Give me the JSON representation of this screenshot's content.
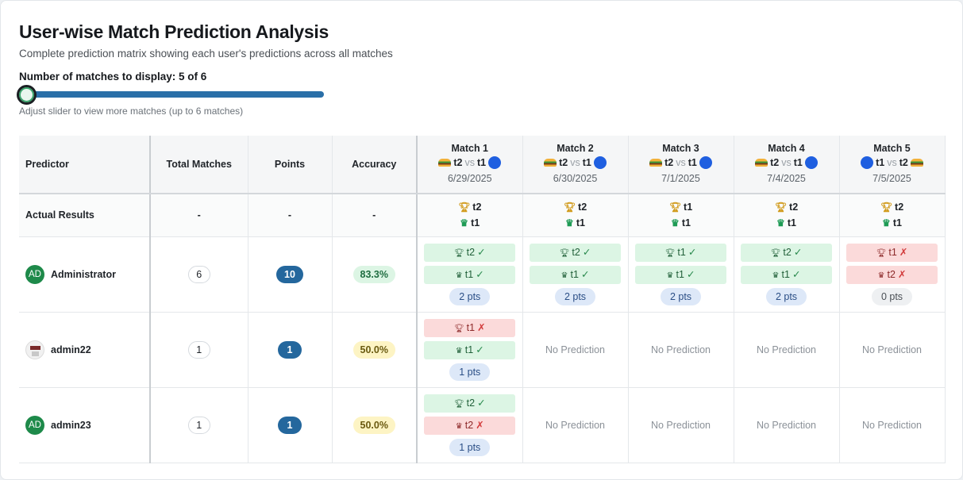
{
  "header": {
    "title": "User-wise Match Prediction Analysis",
    "subtitle": "Complete prediction matrix showing each user's predictions across all matches"
  },
  "slider": {
    "label": "Number of matches to display: 5 of 6",
    "value": 5,
    "max": 6,
    "hint": "Adjust slider to view more matches (up to 6 matches)"
  },
  "table": {
    "columns": {
      "predictor": "Predictor",
      "total": "Total Matches",
      "points": "Points",
      "accuracy": "Accuracy"
    },
    "vs": "vs",
    "matches": [
      {
        "title": "Match 1",
        "team_a": "t2",
        "team_b": "t1",
        "date": "6/29/2025"
      },
      {
        "title": "Match 2",
        "team_a": "t2",
        "team_b": "t1",
        "date": "6/30/2025"
      },
      {
        "title": "Match 3",
        "team_a": "t2",
        "team_b": "t1",
        "date": "7/1/2025"
      },
      {
        "title": "Match 4",
        "team_a": "t2",
        "team_b": "t1",
        "date": "7/4/2025"
      },
      {
        "title": "Match 5",
        "team_a": "t1",
        "team_b": "t2",
        "date": "7/5/2025"
      }
    ],
    "actual": {
      "label": "Actual Results",
      "total": "-",
      "points": "-",
      "accuracy": "-",
      "results": [
        {
          "winner": "t2",
          "second": "t1"
        },
        {
          "winner": "t2",
          "second": "t1"
        },
        {
          "winner": "t1",
          "second": "t1"
        },
        {
          "winner": "t2",
          "second": "t1"
        },
        {
          "winner": "t2",
          "second": "t1"
        }
      ]
    },
    "no_prediction": "No Prediction",
    "users": [
      {
        "name": "Administrator",
        "initials": "AD",
        "total": "6",
        "points": "10",
        "accuracy": "83.3%",
        "predictions": [
          {
            "winner": "t2",
            "winner_ok": true,
            "second": "t1",
            "second_ok": true,
            "pts": "2 pts"
          },
          {
            "winner": "t2",
            "winner_ok": true,
            "second": "t1",
            "second_ok": true,
            "pts": "2 pts"
          },
          {
            "winner": "t1",
            "winner_ok": true,
            "second": "t1",
            "second_ok": true,
            "pts": "2 pts"
          },
          {
            "winner": "t2",
            "winner_ok": true,
            "second": "t1",
            "second_ok": true,
            "pts": "2 pts"
          },
          {
            "winner": "t1",
            "winner_ok": false,
            "second": "t2",
            "second_ok": false,
            "pts": "0 pts"
          }
        ]
      },
      {
        "name": "admin22",
        "initials": "",
        "total": "1",
        "points": "1",
        "accuracy": "50.0%",
        "predictions": [
          {
            "winner": "t1",
            "winner_ok": false,
            "second": "t1",
            "second_ok": true,
            "pts": "1 pts"
          },
          null,
          null,
          null,
          null
        ]
      },
      {
        "name": "admin23",
        "initials": "AD",
        "total": "1",
        "points": "1",
        "accuracy": "50.0%",
        "predictions": [
          {
            "winner": "t2",
            "winner_ok": true,
            "second": "t2",
            "second_ok": false,
            "pts": "1 pts"
          },
          null,
          null,
          null,
          null
        ]
      }
    ]
  }
}
